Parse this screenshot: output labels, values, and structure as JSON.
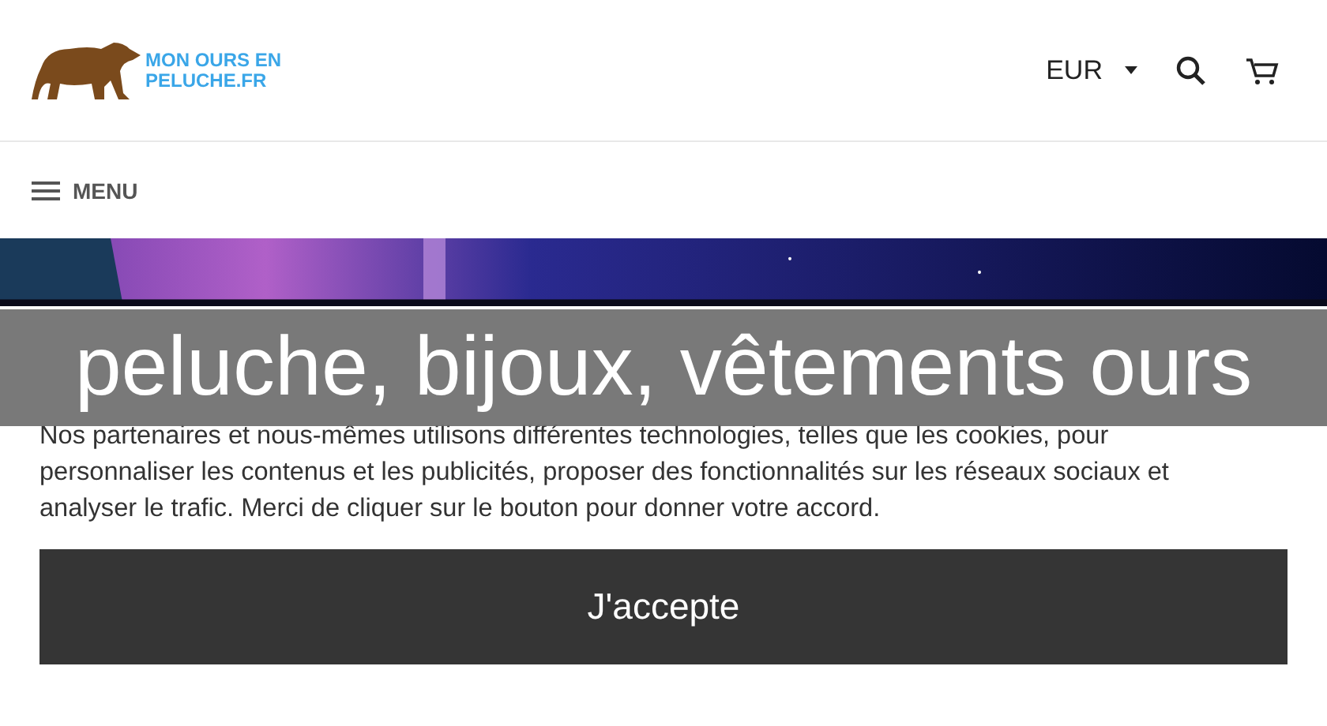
{
  "header": {
    "logo_text": [
      "MON OURS EN",
      "PELUCHE.FR"
    ],
    "currency": "EUR"
  },
  "nav": {
    "menu_label": "MENU"
  },
  "overlay_banner": "peluche, bijoux, vêtements ours",
  "cookie_notice": {
    "text": "Nos partenaires et nous-mêmes utilisons différentes technologies, telles que les cookies, pour personnaliser les contenus et les publicités, proposer des fonctionnalités sur les réseaux sociaux et analyser le trafic. Merci de cliquer sur le bouton pour donner votre accord.",
    "button": "J'accepte"
  }
}
